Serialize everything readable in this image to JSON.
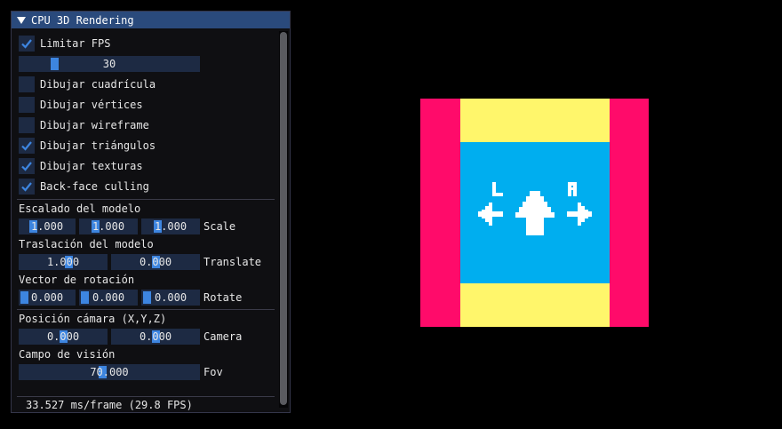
{
  "window": {
    "title": "CPU 3D Rendering",
    "limit_fps": {
      "label": "Limitar FPS",
      "checked": true
    },
    "fps_slider": {
      "value": "30",
      "fraction": 0.25
    },
    "checkboxes": [
      {
        "label": "Dibujar cuadrícula",
        "checked": false
      },
      {
        "label": "Dibujar vértices",
        "checked": false
      },
      {
        "label": "Dibujar wireframe",
        "checked": false
      },
      {
        "label": "Dibujar triángulos",
        "checked": true
      },
      {
        "label": "Dibujar texturas",
        "checked": true
      },
      {
        "label": "Back-face culling",
        "checked": true
      }
    ],
    "scale": {
      "heading": "Escalado del modelo",
      "label": "Scale",
      "values": [
        "1.000",
        "1.000",
        "1.000"
      ]
    },
    "translate": {
      "heading": "Traslación del modelo",
      "label": "Translate",
      "values": [
        "1.000",
        "0.000"
      ]
    },
    "rotate": {
      "heading": "Vector de rotación",
      "label": "Rotate",
      "values": [
        "0.000",
        "0.000",
        "0.000"
      ]
    },
    "camera": {
      "heading": "Posición cámara (X,Y,Z)",
      "label": "Camera",
      "values": [
        "0.000",
        "0.000"
      ]
    },
    "fov": {
      "heading": "Campo de visión",
      "label": "Fov",
      "value": "70.000"
    },
    "footer": "33.527 ms/frame (29.8 FPS)"
  },
  "render": {
    "colors": {
      "magenta": "#ff0b6a",
      "yellow": "#fff66b",
      "cyan": "#00aeef",
      "white": "#ffffff"
    },
    "letters": [
      "L",
      "R"
    ]
  },
  "colors": {
    "accent": "#3d85e0",
    "frame": "#1d2a43",
    "title": "#2a4a7c"
  }
}
